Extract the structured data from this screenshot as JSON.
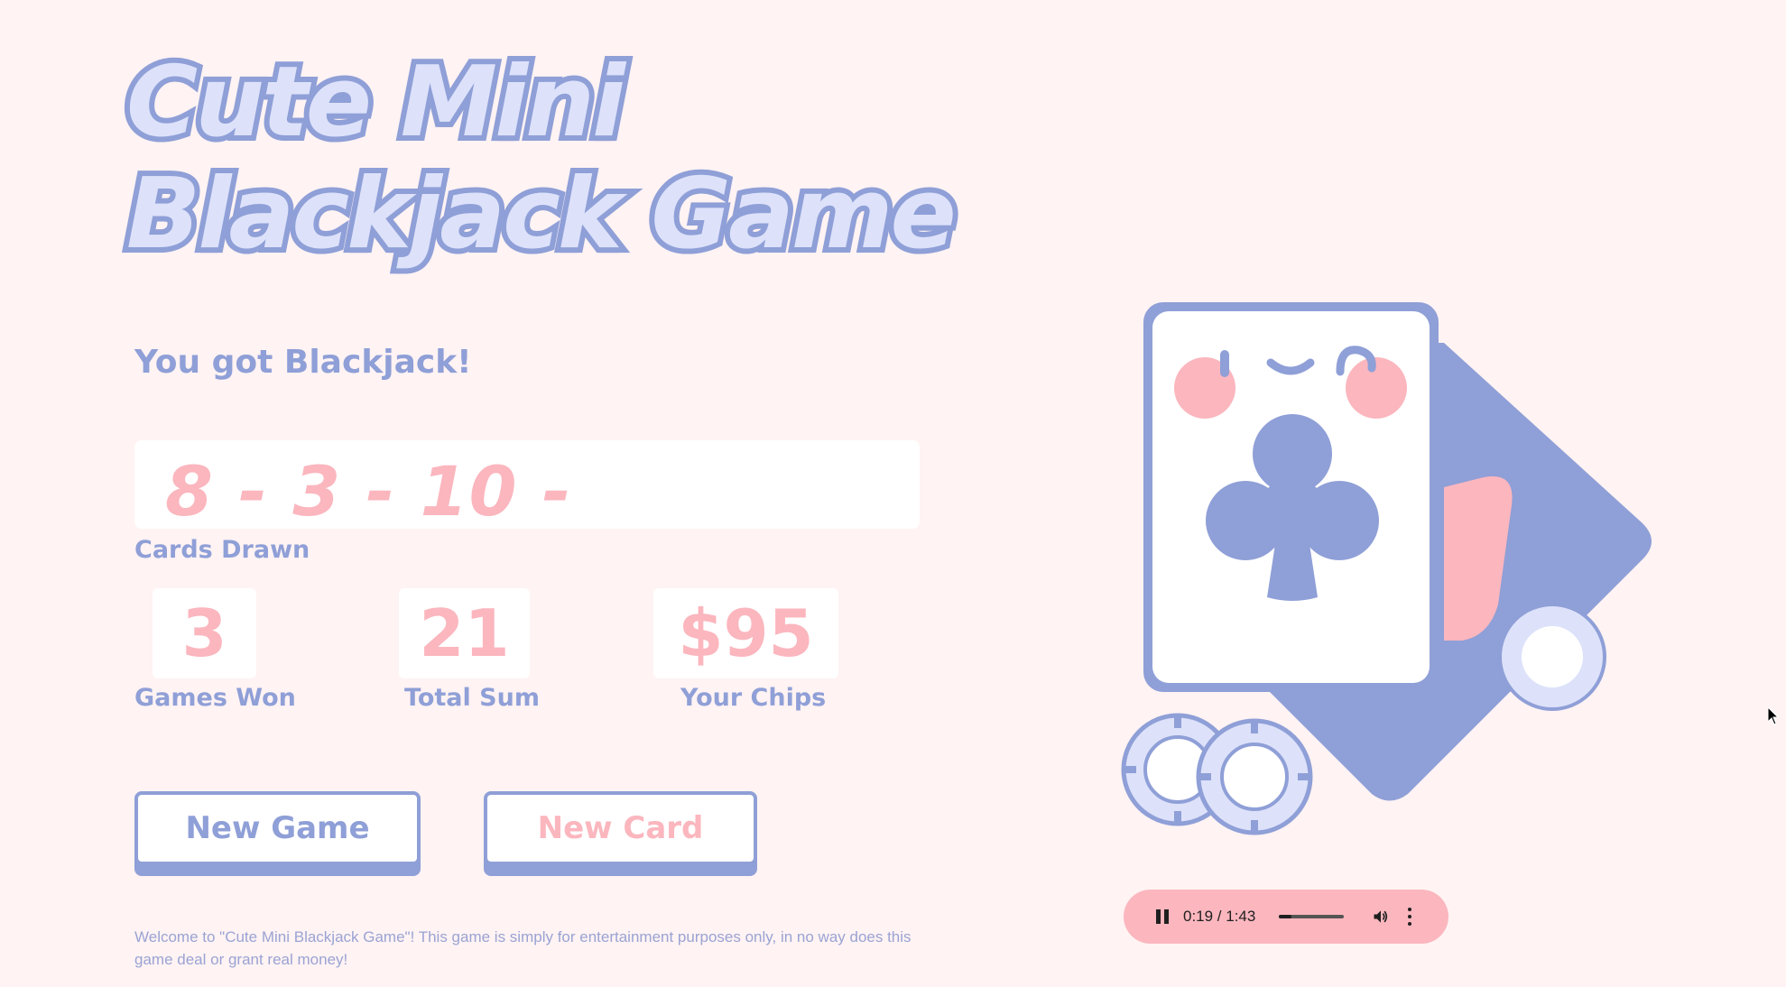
{
  "title": {
    "line1": "Cute Mini",
    "line2": "Blackjack Game"
  },
  "message": "You got Blackjack!",
  "cards": {
    "drawn_text": "8 - 3 - 10 - ",
    "label": "Cards Drawn"
  },
  "stats": {
    "games_won": {
      "value": "3",
      "label": "Games Won"
    },
    "total_sum": {
      "value": "21",
      "label": "Total Sum"
    },
    "chips": {
      "value": "$95",
      "label": "Your Chips"
    }
  },
  "buttons": {
    "new_game": "New Game",
    "new_card": "New Card"
  },
  "disclaimer": "Welcome to \"Cute Mini Blackjack Game\"! This game is simply for entertainment purposes only, in no way does this game deal or grant real money!",
  "audio_player": {
    "time": "0:19 / 1:43",
    "progress": 0.184,
    "state": "playing"
  },
  "colors": {
    "background": "#fff3f3",
    "accent_blue": "#8f9fd7",
    "accent_pink": "#fbb6be",
    "title_fill": "#dde2fa"
  },
  "icons": {
    "illustration": "cute-club-card-with-chips",
    "audio_pause": "pause-icon",
    "audio_volume": "volume-icon",
    "audio_menu": "more-vert-icon",
    "cursor": "mouse-pointer"
  }
}
